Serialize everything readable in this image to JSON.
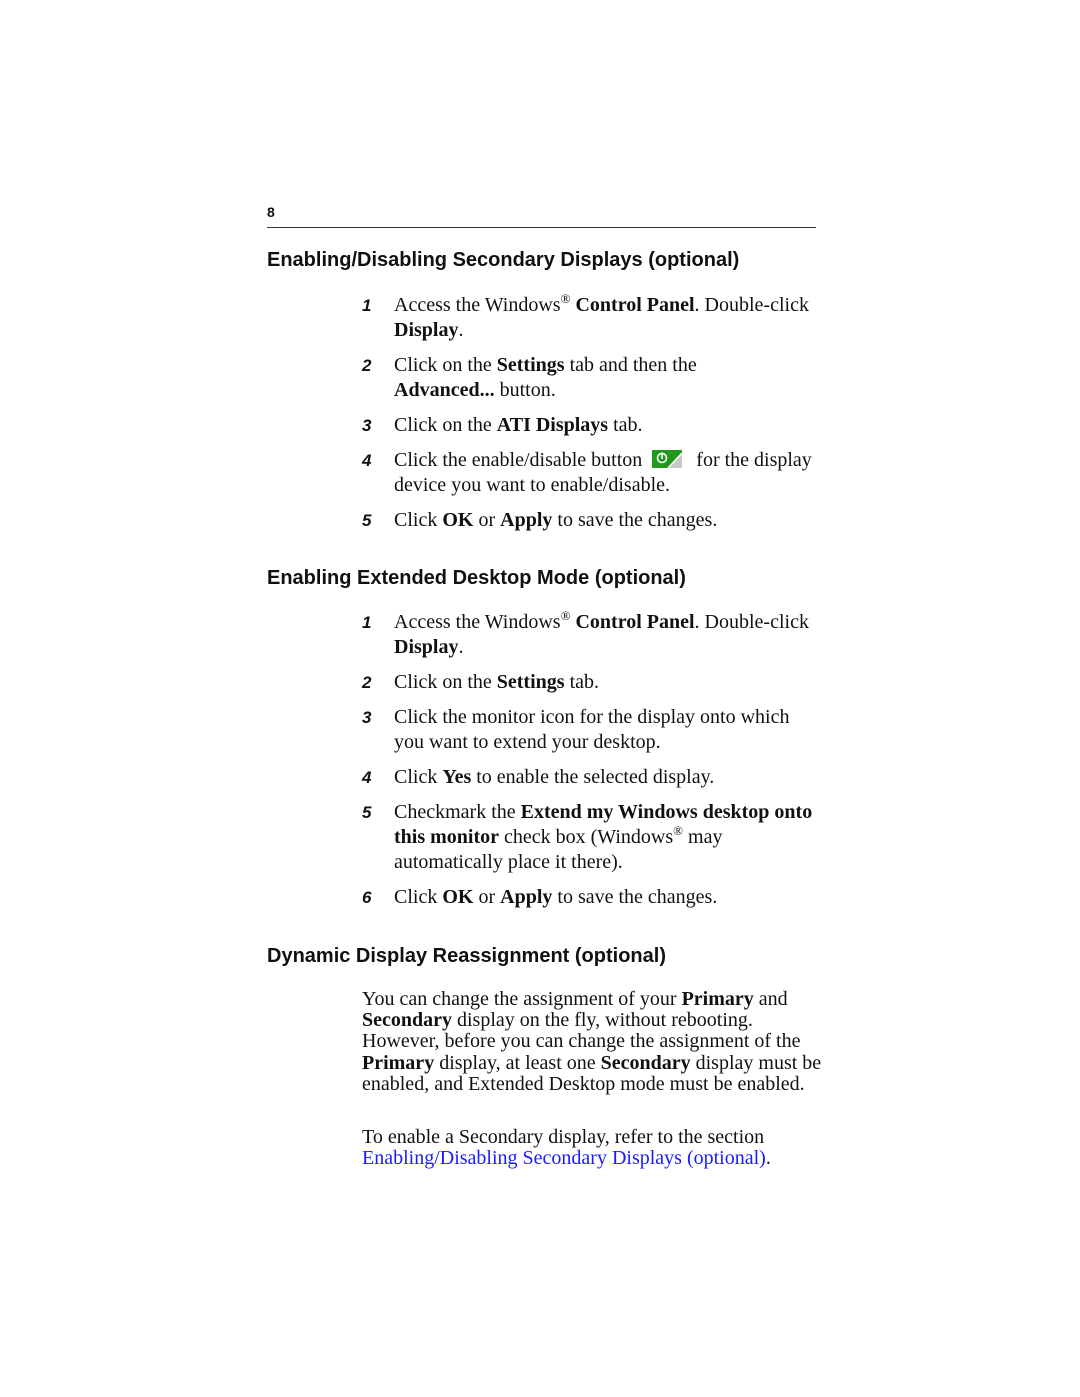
{
  "page_number": "8",
  "sections": [
    {
      "heading": "Enabling/Disabling Secondary Displays (optional)",
      "steps": [
        {
          "num": "1",
          "parts": [
            "Access the Windows",
            "®",
            " ",
            "Control Panel",
            ". Double-click ",
            "Display",
            "."
          ]
        },
        {
          "num": "2",
          "parts": [
            "Click on the ",
            "Settings",
            " tab and then the ",
            "Advanced...",
            " button."
          ]
        },
        {
          "num": "3",
          "parts": [
            "Click on the ",
            "ATI Displays",
            " tab."
          ]
        },
        {
          "num": "4",
          "parts": [
            "Click the enable/disable button",
            "for the display device you want to enable/disable."
          ],
          "icon": "enable-disable-button-icon"
        },
        {
          "num": "5",
          "parts": [
            "Click ",
            "OK",
            " or ",
            "Apply",
            " to save the changes."
          ]
        }
      ]
    },
    {
      "heading": "Enabling Extended Desktop Mode (optional)",
      "steps": [
        {
          "num": "1",
          "parts": [
            "Access the Windows",
            "®",
            " ",
            "Control Panel",
            ". Double-click ",
            "Display",
            "."
          ]
        },
        {
          "num": "2",
          "parts": [
            "Click on the ",
            "Settings",
            " tab."
          ]
        },
        {
          "num": "3",
          "parts": [
            "Click the monitor icon for the display onto which you want to extend your desktop."
          ]
        },
        {
          "num": "4",
          "parts": [
            "Click ",
            "Yes",
            " to enable the selected display."
          ]
        },
        {
          "num": "5",
          "parts": [
            "Checkmark the ",
            "Extend my Windows desktop onto this monitor",
            " check box (Windows",
            "®",
            " may automatically place it there)."
          ]
        },
        {
          "num": "6",
          "parts": [
            "Click ",
            "OK",
            " or ",
            "Apply",
            " to save the changes."
          ]
        }
      ]
    },
    {
      "heading": "Dynamic Display Reassignment (optional)",
      "paragraph1": [
        "You can change the assignment of your ",
        "Primary",
        " and ",
        "Secondary",
        " display on the fly, without rebooting. However, before you can change the assignment of the ",
        "Primary",
        " display, at least one ",
        "Secondary",
        " display must be enabled, and Extended Desktop mode must be enabled."
      ],
      "paragraph2": {
        "text": "To enable a Secondary display, refer to the section ",
        "link": "Enabling/Disabling Secondary Displays (optional)",
        "suffix": "."
      }
    }
  ],
  "colors": {
    "link": "#1a1aff",
    "icon_green": "#1f9a1f",
    "icon_gray": "#c8c8c8"
  }
}
